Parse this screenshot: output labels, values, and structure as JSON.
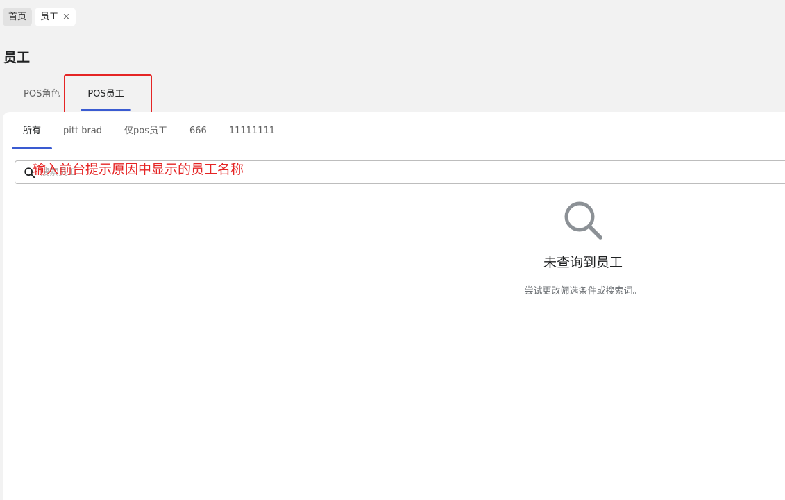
{
  "page_tabs": [
    {
      "label": "首页"
    },
    {
      "label": "员工",
      "close": "×"
    }
  ],
  "page_title": "员工",
  "section_tabs": [
    {
      "label": "POS角色"
    },
    {
      "label": "POS员工"
    }
  ],
  "filter_tabs": [
    {
      "label": "所有"
    },
    {
      "label": "pitt brad"
    },
    {
      "label": "仅pos员工"
    },
    {
      "label": "666"
    },
    {
      "label": "11111111"
    }
  ],
  "search": {
    "placeholder": "搜索员工",
    "annotation": "输入前台提示原因中显示的员工名称"
  },
  "empty_state": {
    "heading": "未查询到员工",
    "subtext": "尝试更改筛选条件或搜索词。",
    "icon": "search-icon"
  },
  "colors": {
    "accent": "#3a5bd1",
    "annotation_red": "#e52525",
    "background": "#f2f2f2"
  }
}
